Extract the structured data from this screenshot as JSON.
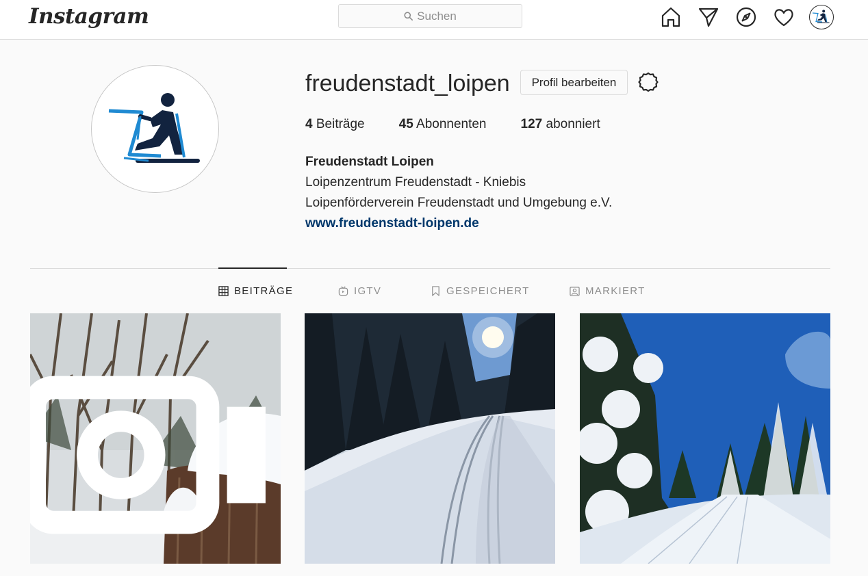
{
  "nav": {
    "logo": "Instagram",
    "search_placeholder": "Suchen"
  },
  "profile": {
    "username": "freudenstadt_loipen",
    "edit_button": "Profil bearbeiten",
    "stats": [
      {
        "count": "4",
        "label": "Beiträge"
      },
      {
        "count": "45",
        "label": "Abonnenten"
      },
      {
        "count": "127",
        "label": "abonniert"
      }
    ],
    "bio": {
      "name": "Freudenstadt Loipen",
      "line1": "Loipenzentrum Freudenstadt - Kniebis",
      "line2": "Loipenförderverein Freudenstadt und Umgebung e.V.",
      "link": "www.freudenstadt-loipen.de"
    }
  },
  "tabs": [
    {
      "label": "BEITRÄGE",
      "icon": "grid-icon",
      "active": true
    },
    {
      "label": "IGTV",
      "icon": "igtv-icon",
      "active": false
    },
    {
      "label": "GESPEICHERT",
      "icon": "bookmark-icon",
      "active": false
    },
    {
      "label": "MARKIERT",
      "icon": "tagged-icon",
      "active": false
    }
  ],
  "posts": [
    {
      "type": "igtv",
      "icon": "igtv-icon"
    },
    {
      "type": "photo"
    },
    {
      "type": "photo"
    }
  ],
  "colors": {
    "text": "#262626",
    "muted": "#8e8e8e",
    "border": "#dbdbdb",
    "link": "#00376b",
    "background": "#fafafa"
  }
}
